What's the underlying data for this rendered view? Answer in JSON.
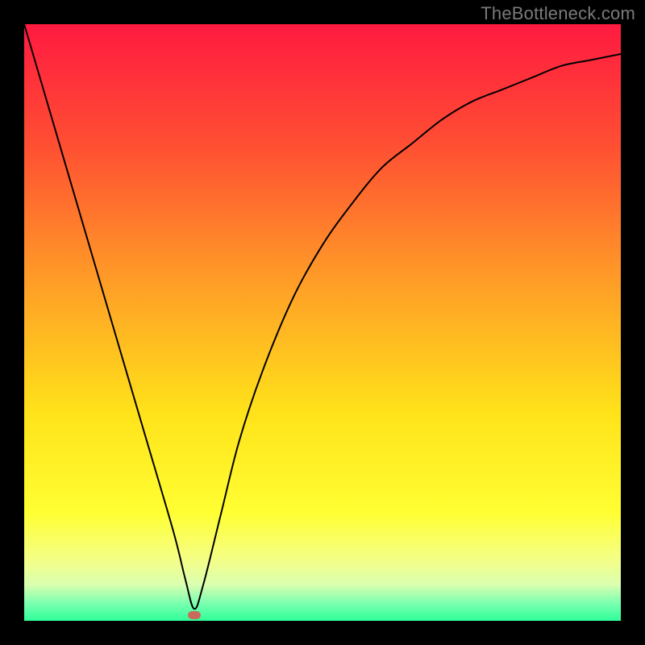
{
  "watermark": {
    "text": "TheBottleneck.com"
  },
  "chart_data": {
    "type": "line",
    "title": "",
    "xlabel": "",
    "ylabel": "",
    "xlim": [
      0,
      100
    ],
    "ylim": [
      0,
      100
    ],
    "legend": false,
    "grid": false,
    "background_gradient_stops": [
      {
        "pct": 0,
        "color": "#ff1a40"
      },
      {
        "pct": 20,
        "color": "#ff4e33"
      },
      {
        "pct": 45,
        "color": "#ffa326"
      },
      {
        "pct": 65,
        "color": "#ffe21a"
      },
      {
        "pct": 82,
        "color": "#ffff33"
      },
      {
        "pct": 90,
        "color": "#f4ff8a"
      },
      {
        "pct": 94,
        "color": "#d9ffb0"
      },
      {
        "pct": 97,
        "color": "#7dffb0"
      },
      {
        "pct": 100,
        "color": "#2eff9a"
      }
    ],
    "series": [
      {
        "name": "bottleneck-curve",
        "x": [
          0,
          5,
          10,
          15,
          20,
          25,
          27,
          28.5,
          30,
          33,
          36,
          40,
          45,
          50,
          55,
          60,
          65,
          70,
          75,
          80,
          85,
          90,
          95,
          100
        ],
        "y": [
          100,
          83,
          66,
          49,
          32,
          15,
          7,
          2,
          6,
          18,
          30,
          42,
          54,
          63,
          70,
          76,
          80,
          84,
          87,
          89,
          91,
          93,
          94,
          95
        ]
      }
    ],
    "marker": {
      "name": "optimal-point",
      "x": 28.5,
      "y": 1,
      "color": "#c96a5a"
    }
  }
}
